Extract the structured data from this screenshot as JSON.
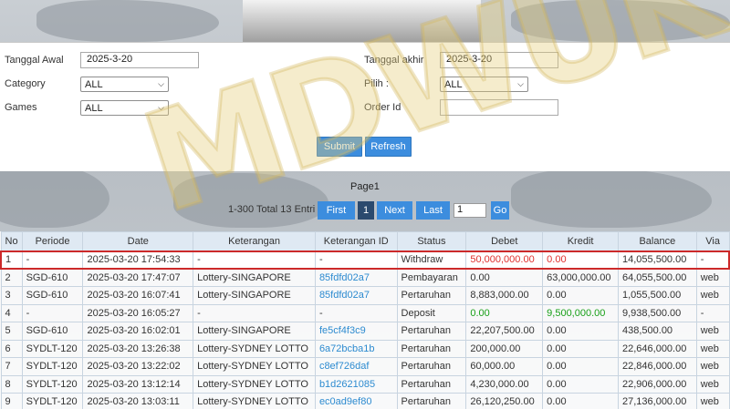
{
  "filters": {
    "tanggal_awal_label": "Tanggal Awal",
    "tanggal_awal_value": "2025-3-20",
    "tanggal_akhir_label": "Tanggal akhir",
    "tanggal_akhir_value": "2025-3-20",
    "category_label": "Category",
    "category_value": "ALL",
    "pilih_label": "Pilih  :",
    "pilih_value": "ALL",
    "games_label": "Games",
    "games_value": "ALL",
    "order_id_label": "Order Id",
    "order_id_value": "",
    "submit_label": "Submit",
    "refresh_label": "Refresh"
  },
  "pager": {
    "page_title": "Page1",
    "info": "1-300 Total 13 Entri",
    "first": "First",
    "current": "1",
    "next": "Next",
    "last": "Last",
    "input_value": "1",
    "go": "Go"
  },
  "table": {
    "headers": [
      "No",
      "Periode",
      "Date",
      "Keterangan",
      "Keterangan ID",
      "Status",
      "Debet",
      "Kredit",
      "Balance",
      "Via"
    ],
    "rows": [
      [
        "1",
        "-",
        "2025-03-20 17:54:33",
        "-",
        "-",
        "Withdraw",
        "50,000,000.00",
        "0.00",
        "14,055,500.00",
        "-"
      ],
      [
        "2",
        "SGD-610",
        "2025-03-20 17:47:07",
        "Lottery-SINGAPORE",
        "85fdfd02a7",
        "Pembayaran",
        "0.00",
        "63,000,000.00",
        "64,055,500.00",
        "web"
      ],
      [
        "3",
        "SGD-610",
        "2025-03-20 16:07:41",
        "Lottery-SINGAPORE",
        "85fdfd02a7",
        "Pertaruhan",
        "8,883,000.00",
        "0.00",
        "1,055,500.00",
        "web"
      ],
      [
        "4",
        "-",
        "2025-03-20 16:05:27",
        "-",
        "-",
        "Deposit",
        "0.00",
        "9,500,000.00",
        "9,938,500.00",
        "-"
      ],
      [
        "5",
        "SGD-610",
        "2025-03-20 16:02:01",
        "Lottery-SINGAPORE",
        "fe5cf4f3c9",
        "Pertaruhan",
        "22,207,500.00",
        "0.00",
        "438,500.00",
        "web"
      ],
      [
        "6",
        "SYDLT-120",
        "2025-03-20 13:26:38",
        "Lottery-SYDNEY LOTTO",
        "6a72bcba1b",
        "Pertaruhan",
        "200,000.00",
        "0.00",
        "22,646,000.00",
        "web"
      ],
      [
        "7",
        "SYDLT-120",
        "2025-03-20 13:22:02",
        "Lottery-SYDNEY LOTTO",
        "c8ef726daf",
        "Pertaruhan",
        "60,000.00",
        "0.00",
        "22,846,000.00",
        "web"
      ],
      [
        "8",
        "SYDLT-120",
        "2025-03-20 13:12:14",
        "Lottery-SYDNEY LOTTO",
        "b1d2621085",
        "Pertaruhan",
        "4,230,000.00",
        "0.00",
        "22,906,000.00",
        "web"
      ],
      [
        "9",
        "SYDLT-120",
        "2025-03-20 13:03:11",
        "Lottery-SYDNEY LOTTO",
        "ec0ad9ef80",
        "Pertaruhan",
        "26,120,250.00",
        "0.00",
        "27,136,000.00",
        "web"
      ]
    ]
  },
  "watermark_text": "MDWUK",
  "colors": {
    "accent": "#3c8dde",
    "highlight_border": "#cc2a2a",
    "debit_red": "#e0302d",
    "credit_green": "#18a018",
    "link": "#2d8bd0"
  }
}
